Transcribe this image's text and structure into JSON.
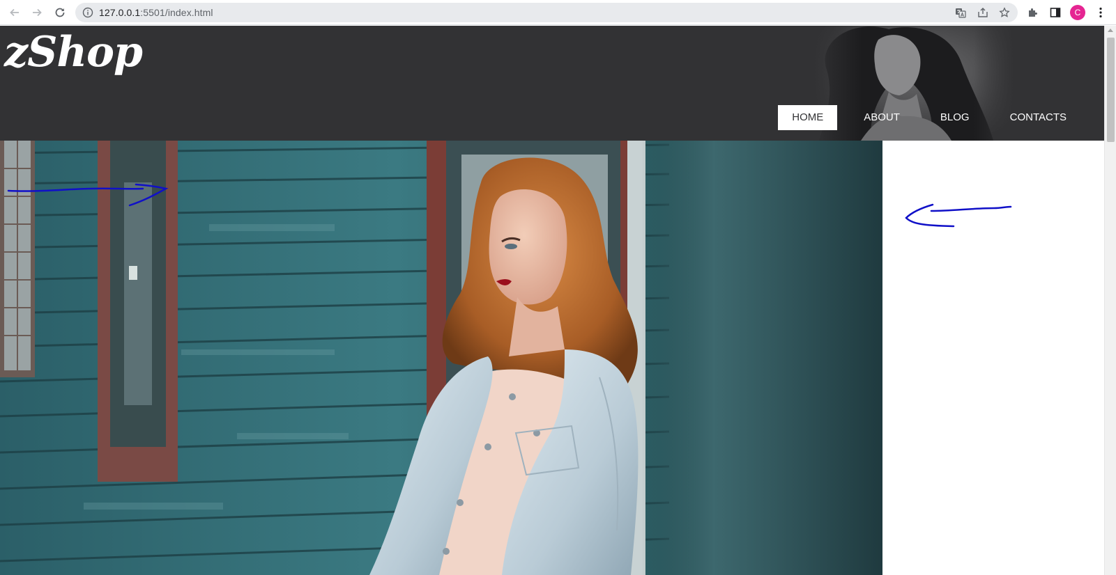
{
  "browser": {
    "url_host": "127.0.0.1",
    "url_path": ":5501/index.html",
    "profile_initial": "C",
    "icons": {
      "back": "back-arrow-icon",
      "forward": "forward-arrow-icon",
      "reload": "reload-icon",
      "site_info": "info-icon",
      "translate": "translate-icon",
      "share": "share-icon",
      "bookmark": "star-icon",
      "extensions": "puzzle-icon",
      "side_panel": "side-panel-icon",
      "menu": "kebab-menu-icon"
    },
    "colors": {
      "avatar": "#e52592",
      "omnibox": "#e8eaed"
    }
  },
  "site": {
    "logo": "zShop",
    "header_bg": "#323234",
    "nav": [
      {
        "label": "HOME",
        "active": true
      },
      {
        "label": "ABOUT",
        "active": false
      },
      {
        "label": "BLOG",
        "active": false
      },
      {
        "label": "CONTACTS",
        "active": false
      }
    ]
  },
  "annotations": {
    "color": "#1010c8",
    "marks": [
      "arrow-pointing-right",
      "arrow-pointing-left"
    ]
  }
}
